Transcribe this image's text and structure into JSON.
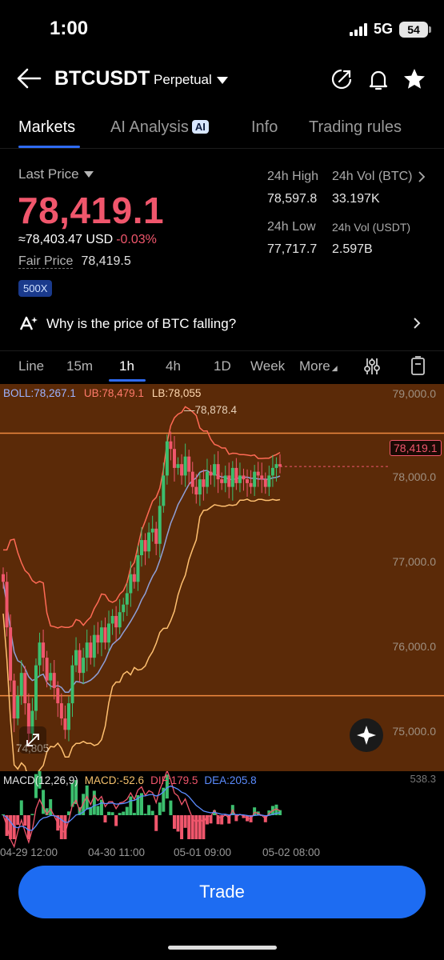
{
  "status": {
    "time": "1:00",
    "network": "5G",
    "battery": "54"
  },
  "header": {
    "pair": "BTCUSDT",
    "contract_type": "Perpetual"
  },
  "tabs": [
    {
      "label": "Markets"
    },
    {
      "label": "AI Analysis",
      "badge": "AI"
    },
    {
      "label": "Info"
    },
    {
      "label": "Trading rules"
    }
  ],
  "ticker": {
    "last_price_label": "Last Price",
    "last_price": "78,419.1",
    "usd_value": "≈78,403.47 USD",
    "change": "-0.03%",
    "fair_price_label": "Fair Price",
    "fair_price": "78,419.5",
    "leverage": "500X",
    "high_label": "24h High",
    "high_value": "78,597.8",
    "vol_btc_label": "24h Vol (BTC)",
    "vol_btc_value": "33.197K",
    "low_label": "24h Low",
    "low_value": "77,717.7",
    "vol_usdt_label": "24h Vol  (USDT)",
    "vol_usdt_value": "2.597B"
  },
  "ai_prompt": {
    "text": "Why is the price of BTC falling?"
  },
  "chart_tabs": [
    "Line",
    "15m",
    "1h",
    "4h",
    "1D",
    "Week",
    "More"
  ],
  "chart_tab_active": "1h",
  "indicators": {
    "boll": "BOLL:78,267.1",
    "ub": "UB:78,479.1",
    "lb": "LB:78,055"
  },
  "price_axis": [
    "79,000.0",
    "78,000.0",
    "77,000.0",
    "76,000.0",
    "75,000.0"
  ],
  "current_price_tag": "78,419.1",
  "high_marker": "78,878.4",
  "low_marker": "74,805",
  "macd": {
    "title": "MACD(12,26,9)",
    "macd": "MACD:-52.6",
    "dif": "DIF:179.5",
    "dea": "DEA:205.8",
    "max": "538.3"
  },
  "time_axis": [
    "04-29 12:00",
    "04-30 11:00",
    "05-01 09:00",
    "05-02 08:00"
  ],
  "trade_button": "Trade",
  "colors": {
    "accent": "#1d6cf2",
    "down": "#f0566c",
    "up": "#3cbf6e",
    "chart_bg": "#5b2a08"
  },
  "chart_data": {
    "type": "candlestick",
    "ylim": [
      74500,
      79400
    ],
    "y_ticks": [
      79000,
      78000,
      77000,
      76000,
      75000
    ],
    "last_price": 78419.1,
    "high": 78878.4,
    "low": 74805,
    "close_approx": [
      76900,
      76300,
      75600,
      75100,
      75400,
      75700,
      75300,
      74900,
      75200,
      75800,
      76100,
      75900,
      75600,
      75700,
      75500,
      75300,
      75100,
      74950,
      75300,
      75800,
      76000,
      75700,
      75900,
      76100,
      75900,
      76200,
      76100,
      76300,
      76100,
      76350,
      76450,
      76300,
      76500,
      76600,
      76750,
      77000,
      76900,
      77250,
      77450,
      77300,
      77550,
      77600,
      77400,
      77900,
      78300,
      78750,
      78650,
      78400,
      78450,
      78300,
      78550,
      78350,
      78150,
      78050,
      78250,
      78150,
      78350,
      78300,
      78450,
      78250,
      78200,
      78300,
      78150,
      78400,
      78200,
      78300,
      78250,
      78200,
      78150,
      78350,
      78300,
      78250,
      78150,
      78300,
      78400,
      78450,
      78419
    ]
  }
}
